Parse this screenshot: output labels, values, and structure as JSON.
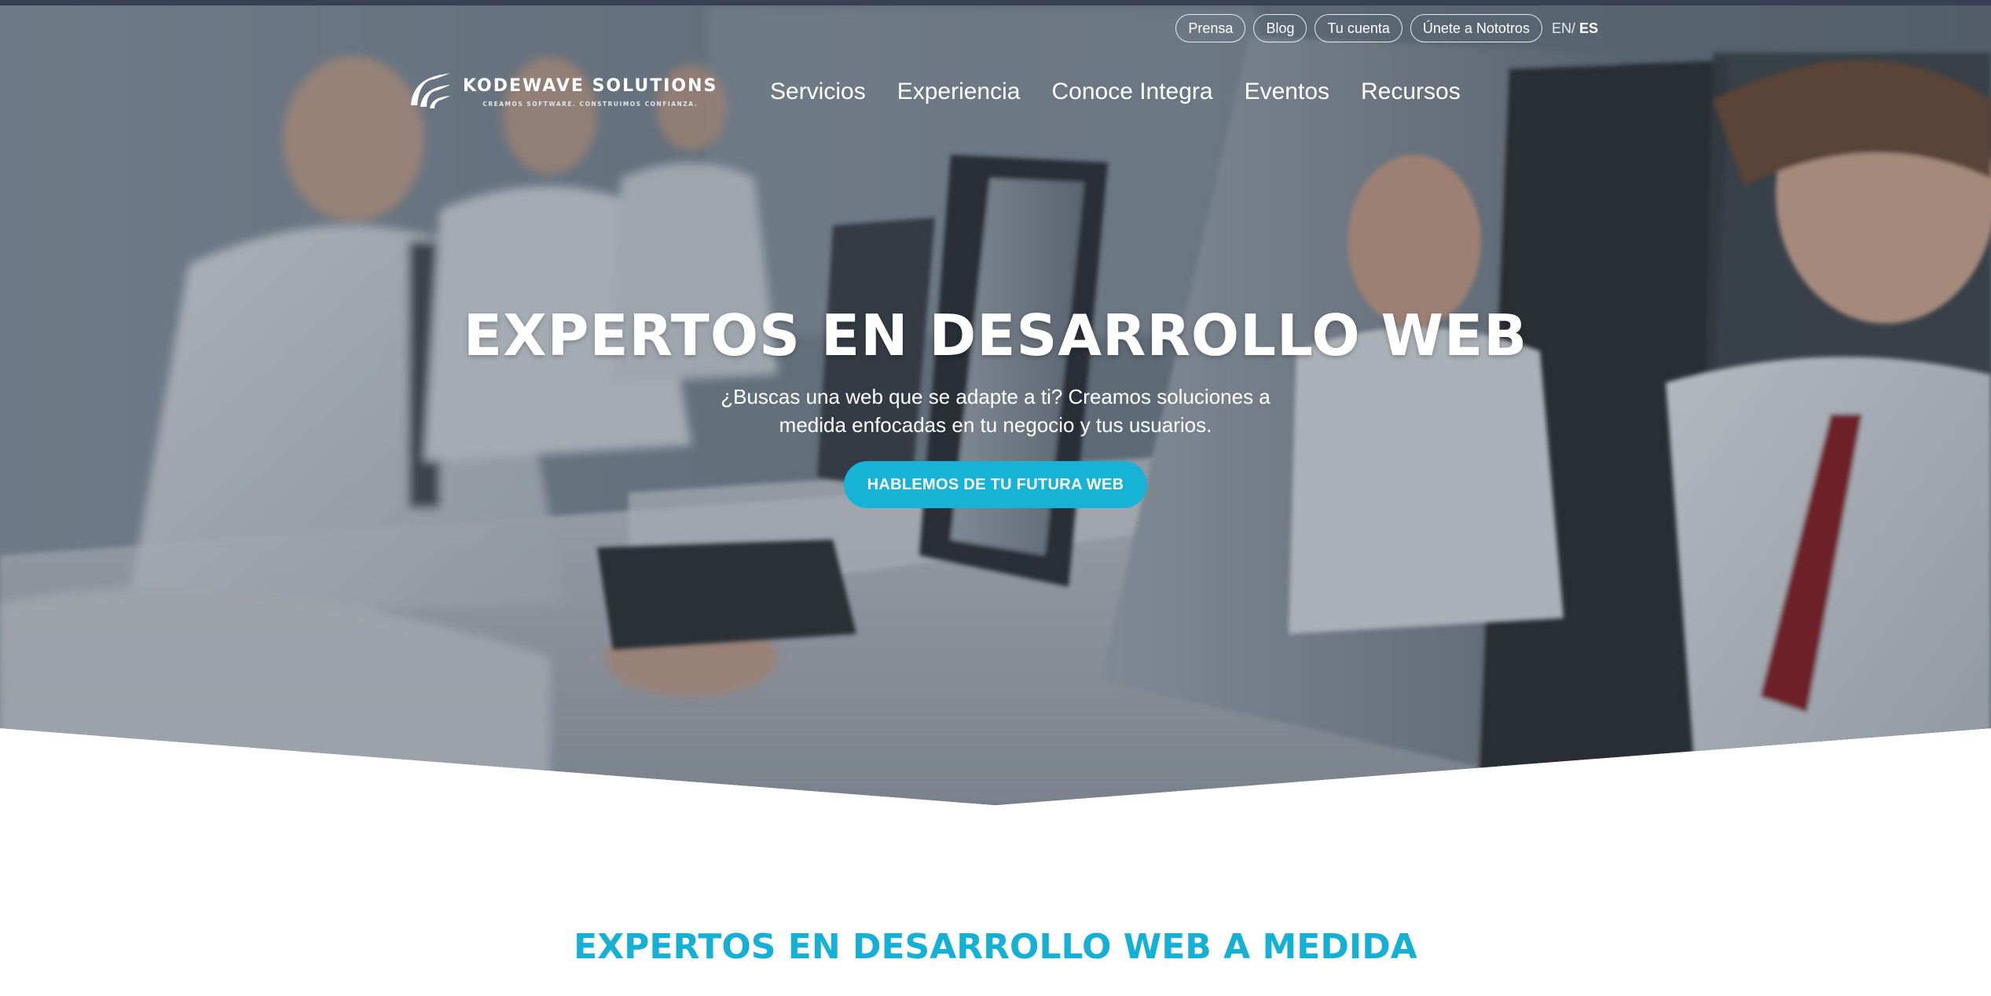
{
  "util_nav": {
    "items": [
      "Prensa",
      "Blog",
      "Tu cuenta",
      "Únete a Nototros"
    ],
    "lang_en": "EN/",
    "lang_es": "ES"
  },
  "logo": {
    "name": "KODEWAVE SOLUTIONS",
    "tagline": "CREAMOS SOFTWARE. CONSTRUIMOS CONFIANZA."
  },
  "main_nav": {
    "items": [
      "Servicios",
      "Experiencia",
      "Conoce Integra",
      "Eventos",
      "Recursos"
    ]
  },
  "hero": {
    "title": "EXPERTOS EN DESARROLLO WEB",
    "subtitle": "¿Buscas una web que se adapte a ti? Creamos soluciones a medida enfocadas en tu negocio y tus usuarios.",
    "cta": "HABLEMOS DE TU FUTURA WEB"
  },
  "section": {
    "title": "EXPERTOS EN DESARROLLO WEB A MEDIDA"
  },
  "colors": {
    "accent": "#17b3d6",
    "heading": "#15b0d4",
    "top_strip": "#3a3f55"
  }
}
